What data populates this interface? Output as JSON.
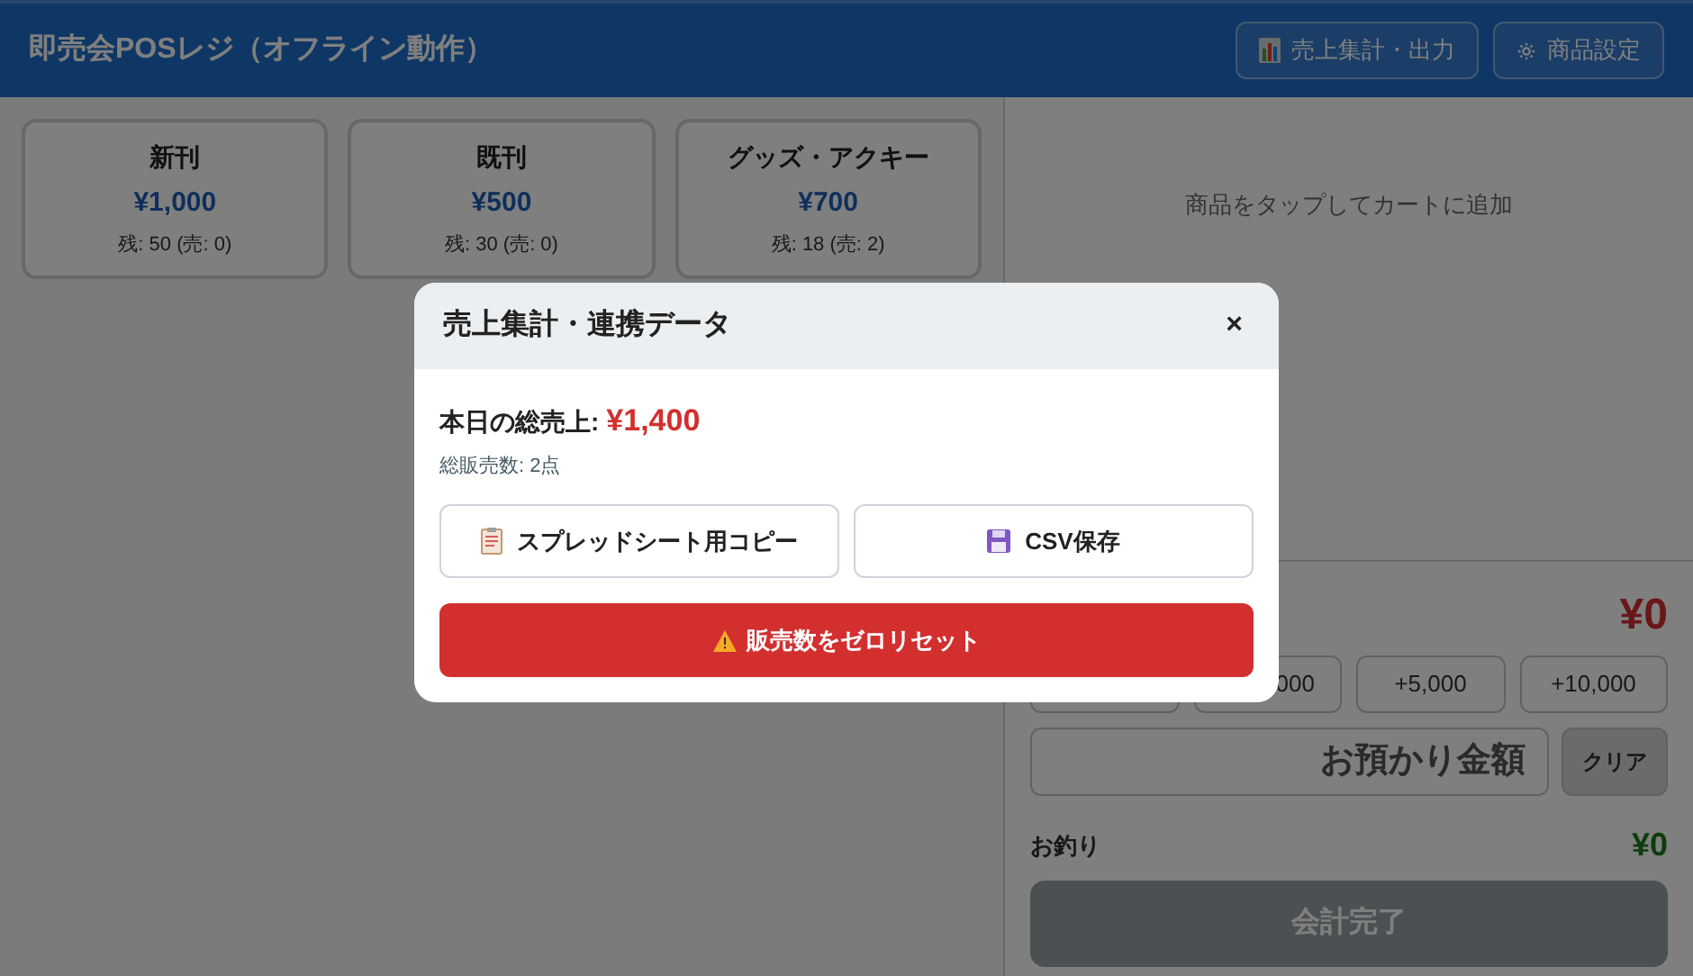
{
  "header": {
    "title": "即売会POSレジ（オフライン動作）",
    "buttons": [
      {
        "label": "売上集計・出力"
      },
      {
        "label": "商品設定"
      }
    ]
  },
  "products": [
    {
      "name": "新刊",
      "price": "¥1,000",
      "stock": "残: 50 (売: 0)"
    },
    {
      "name": "既刊",
      "price": "¥500",
      "stock": "残: 30 (売: 0)"
    },
    {
      "name": "グッズ・アクキー",
      "price": "¥700",
      "stock": "残: 18 (売: 2)"
    }
  ],
  "cart": {
    "empty_message": "商品をタップしてカートに追加"
  },
  "checkout": {
    "total": "¥0",
    "quick_amounts": [
      {
        "kind": "hidden"
      },
      {
        "kind": "partial",
        "label": "000"
      },
      {
        "kind": "full",
        "label": "+5,000"
      },
      {
        "kind": "full",
        "label": "+10,000"
      }
    ],
    "tendered": {
      "placeholder": "お預かり金額"
    },
    "clear_button": "クリア",
    "change_label": "お釣り",
    "change": "¥0",
    "complete_button": {
      "label": "会計完了",
      "disabled": true
    }
  },
  "modal": {
    "title": "売上集計・連携データ",
    "close": "×",
    "total_label": "本日の総売上:",
    "total": "¥1,400",
    "count": "総販売数: 2点",
    "actions": [
      {
        "label": "スプレッドシート用コピー"
      },
      {
        "label": "CSV保存"
      }
    ],
    "reset_button": "販売数をゼロリセット"
  }
}
